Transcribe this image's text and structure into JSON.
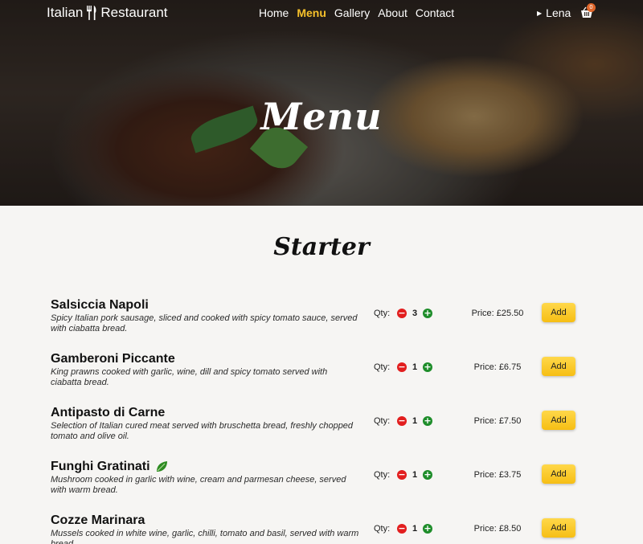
{
  "nav": {
    "brand_left": "Italian",
    "brand_right": "Restaurant",
    "links": [
      {
        "label": "Home"
      },
      {
        "label": "Menu",
        "active": true
      },
      {
        "label": "Gallery"
      },
      {
        "label": "About"
      },
      {
        "label": "Contact"
      }
    ],
    "user_name": "Lena",
    "cart_count": "0"
  },
  "hero": {
    "title": "Menu"
  },
  "section": {
    "title": "Starter"
  },
  "labels": {
    "qty": "Qty:",
    "add": "Add",
    "minus": "−",
    "plus": "+"
  },
  "items": [
    {
      "name": "Salsiccia Napoli",
      "desc": "Spicy Italian pork sausage, sliced and cooked with spicy tomato sauce, served with ciabatta bread.",
      "qty": "3",
      "price": "Price: £25.50",
      "vegetarian": false
    },
    {
      "name": "Gamberoni Piccante",
      "desc": "King prawns cooked with garlic, wine, dill and spicy tomato served with ciabatta bread.",
      "qty": "1",
      "price": "Price: £6.75",
      "vegetarian": false
    },
    {
      "name": "Antipasto di Carne",
      "desc": "Selection of Italian cured meat served with bruschetta bread, freshly chopped tomato and olive oil.",
      "qty": "1",
      "price": "Price: £7.50",
      "vegetarian": false
    },
    {
      "name": "Funghi Gratinati",
      "desc": "Mushroom cooked in garlic with wine, cream and parmesan cheese, served with warm bread.",
      "qty": "1",
      "price": "Price: £3.75",
      "vegetarian": true
    },
    {
      "name": "Cozze Marinara",
      "desc": "Mussels cooked in white wine, garlic, chilli, tomato and basil, served with warm bread.",
      "qty": "1",
      "price": "Price: £8.50",
      "vegetarian": false
    }
  ],
  "colors": {
    "accent": "#f6c12b",
    "minus": "#e21e1e",
    "plus": "#1e8d2a",
    "veg": "#2e8b22",
    "badge": "#e0662a"
  },
  "icons": {
    "brand": "utensils-icon",
    "user": "caret-right-icon",
    "cart": "basket-icon",
    "veg": "leaf-icon"
  }
}
